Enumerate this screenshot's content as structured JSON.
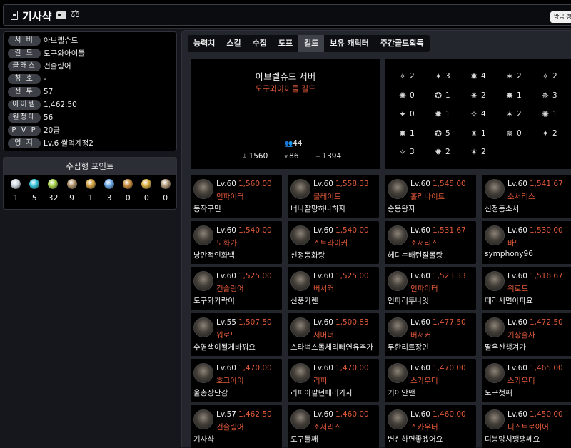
{
  "header": {
    "name": "기사샥",
    "update_label": "방금 갱신"
  },
  "profile": [
    {
      "label": "서 버",
      "value": "아브렐슈드"
    },
    {
      "label": "길 드",
      "value": "도구와아이들"
    },
    {
      "label": "클래스",
      "value": "건슬링어"
    },
    {
      "label": "칭 호",
      "value": "-"
    },
    {
      "label": "전 투",
      "value": "57"
    },
    {
      "label": "아이템",
      "value": "1,462.50"
    },
    {
      "label": "원정대",
      "value": "56"
    },
    {
      "label": "P V P",
      "value": "20급"
    },
    {
      "label": "영 지",
      "value": "Lv.6 쌀먹계정2"
    }
  ],
  "collection": {
    "title": "수집형 포인트",
    "items": [
      {
        "icon": "island-heart-icon",
        "color": "#cfd6e0",
        "count": "1"
      },
      {
        "icon": "orpheus-star-icon",
        "color": "#38c6d8",
        "count": "5"
      },
      {
        "icon": "mokoko-seed-icon",
        "color": "#a6d24a",
        "count": "32"
      },
      {
        "icon": "great-art-icon",
        "color": "#b0906a",
        "count": "9"
      },
      {
        "icon": "adventure-icon",
        "color": "#d2a040",
        "count": "1"
      },
      {
        "icon": "world-tree-leaf-icon",
        "color": "#6aa8e8",
        "count": "3"
      },
      {
        "icon": "ignea-token-icon",
        "color": "#c88c3c",
        "count": "0"
      },
      {
        "icon": "sea-bounty-icon",
        "color": "#d8b040",
        "count": "0"
      },
      {
        "icon": "giant-heart-icon",
        "color": "#b09878",
        "count": "0"
      }
    ]
  },
  "tabs": [
    {
      "label": "능력치",
      "active": false
    },
    {
      "label": "스킬",
      "active": false
    },
    {
      "label": "수집",
      "active": false
    },
    {
      "label": "도표",
      "active": false
    },
    {
      "label": "길드",
      "active": true
    },
    {
      "label": "보유 캐릭터",
      "active": false
    },
    {
      "label": "주간골드획득",
      "active": false
    }
  ],
  "guild": {
    "server": "아브렐슈드 서버",
    "name": "도구와아이들 길드",
    "member_count": "44",
    "stat_a": "1560",
    "stat_b": "86",
    "stat_c": "1394"
  },
  "class_counts": [
    {
      "icon": "class-icon-1",
      "count": "2"
    },
    {
      "icon": "class-icon-2",
      "count": "3"
    },
    {
      "icon": "class-icon-3",
      "count": "4"
    },
    {
      "icon": "class-icon-4",
      "count": "2"
    },
    {
      "icon": "class-icon-5",
      "count": "2"
    },
    {
      "icon": "class-icon-6",
      "count": "0"
    },
    {
      "icon": "class-icon-7",
      "count": "1"
    },
    {
      "icon": "class-icon-8",
      "count": "2"
    },
    {
      "icon": "class-icon-9",
      "count": "1"
    },
    {
      "icon": "class-icon-10",
      "count": "3"
    },
    {
      "icon": "class-icon-11",
      "count": "0"
    },
    {
      "icon": "class-icon-12",
      "count": "1"
    },
    {
      "icon": "class-icon-13",
      "count": "4"
    },
    {
      "icon": "class-icon-14",
      "count": "2"
    },
    {
      "icon": "class-icon-15",
      "count": "1"
    },
    {
      "icon": "class-icon-16",
      "count": "1"
    },
    {
      "icon": "class-icon-17",
      "count": "5"
    },
    {
      "icon": "class-icon-18",
      "count": "1"
    },
    {
      "icon": "class-icon-19",
      "count": "0"
    },
    {
      "icon": "class-icon-20",
      "count": "2"
    },
    {
      "icon": "class-icon-21",
      "count": "3"
    },
    {
      "icon": "class-icon-22",
      "count": "2"
    },
    {
      "icon": "class-icon-23",
      "count": "2"
    }
  ],
  "members": [
    {
      "level": "Lv.60",
      "item_level": "1,560.00",
      "job": "인파이터",
      "nick": "동작구민"
    },
    {
      "level": "Lv.60",
      "item_level": "1,558.33",
      "job": "블레이드",
      "nick": "너나잘망하나하자"
    },
    {
      "level": "Lv.60",
      "item_level": "1,545.00",
      "job": "홀리나이트",
      "nick": "송용왕자"
    },
    {
      "level": "Lv.60",
      "item_level": "1,541.67",
      "job": "소서리스",
      "nick": "신정동소서"
    },
    {
      "level": "Lv.60",
      "item_level": "1,540.00",
      "job": "도화가",
      "nick": "낭만적인화백"
    },
    {
      "level": "Lv.60",
      "item_level": "1,540.00",
      "job": "스트라이커",
      "nick": "신정동화랑"
    },
    {
      "level": "Lv.60",
      "item_level": "1,531.67",
      "job": "소서리스",
      "nick": "헤디는배턴잘몰랑"
    },
    {
      "level": "Lv.60",
      "item_level": "1,530.00",
      "job": "바드",
      "nick": "symphony96"
    },
    {
      "level": "Lv.60",
      "item_level": "1,525.00",
      "job": "건슬링어",
      "nick": "도구와가락이"
    },
    {
      "level": "Lv.60",
      "item_level": "1,525.00",
      "job": "버서커",
      "nick": "신풍가렌"
    },
    {
      "level": "Lv.60",
      "item_level": "1,523.33",
      "job": "인파이터",
      "nick": "인파리투나잇"
    },
    {
      "level": "Lv.60",
      "item_level": "1,516.67",
      "job": "워로드",
      "nick": "때리시면아파요"
    },
    {
      "level": "Lv.55",
      "item_level": "1,507.50",
      "job": "워로드",
      "nick": "수염색이될게바꿔요"
    },
    {
      "level": "Lv.60",
      "item_level": "1,500.83",
      "job": "서머너",
      "nick": "스타벅스돌체리빠연유추가"
    },
    {
      "level": "Lv.60",
      "item_level": "1,477.50",
      "job": "버서커",
      "nick": "무한리트장인"
    },
    {
      "level": "Lv.60",
      "item_level": "1,472.50",
      "job": "기상술사",
      "nick": "딸우산챙겨가"
    },
    {
      "level": "Lv.60",
      "item_level": "1,470.00",
      "job": "호크아이",
      "nick": "울총장난감"
    },
    {
      "level": "Lv.60",
      "item_level": "1,470.00",
      "job": "리퍼",
      "nick": "리퍼아팔던페러가자"
    },
    {
      "level": "Lv.60",
      "item_level": "1,470.00",
      "job": "스카우터",
      "nick": "기이안맨"
    },
    {
      "level": "Lv.60",
      "item_level": "1,465.00",
      "job": "스카우터",
      "nick": "도구첫째"
    },
    {
      "level": "Lv.57",
      "item_level": "1,462.50",
      "job": "건슬링어",
      "nick": "기사샥"
    },
    {
      "level": "Lv.60",
      "item_level": "1,460.00",
      "job": "소서리스",
      "nick": "도구둘째"
    },
    {
      "level": "Lv.60",
      "item_level": "1,460.00",
      "job": "스카우터",
      "nick": "변신하면좋겠어요"
    },
    {
      "level": "Lv.60",
      "item_level": "1,450.00",
      "job": "디스트로이어",
      "nick": "디붕망치쨍쨍쎄요"
    }
  ]
}
